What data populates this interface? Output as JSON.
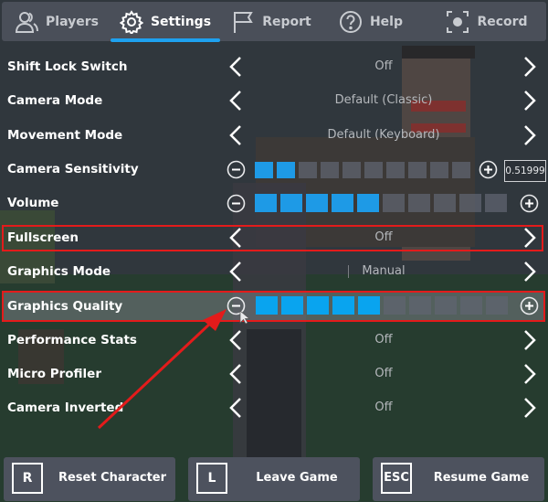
{
  "tabs": [
    {
      "label": "Players",
      "icon": "players-icon",
      "active": false
    },
    {
      "label": "Settings",
      "icon": "gear-icon",
      "active": true
    },
    {
      "label": "Report",
      "icon": "flag-icon",
      "active": false
    },
    {
      "label": "Help",
      "icon": "help-icon",
      "active": false
    },
    {
      "label": "Record",
      "icon": "record-icon",
      "active": false
    }
  ],
  "settings": {
    "shift_lock": {
      "label": "Shift Lock Switch",
      "value": "Off"
    },
    "camera_mode": {
      "label": "Camera Mode",
      "value": "Default (Classic)"
    },
    "movement_mode": {
      "label": "Movement Mode",
      "value": "Default (Keyboard)"
    },
    "camera_sensitivity": {
      "label": "Camera Sensitivity",
      "level": 2,
      "max": 10,
      "value": "0.51999"
    },
    "volume": {
      "label": "Volume",
      "level": 5,
      "max": 10
    },
    "fullscreen": {
      "label": "Fullscreen",
      "value": "Off"
    },
    "graphics_mode": {
      "label": "Graphics Mode",
      "value": "Manual"
    },
    "graphics_quality": {
      "label": "Graphics Quality",
      "level": 5,
      "max": 10
    },
    "performance_stats": {
      "label": "Performance Stats",
      "value": "Off"
    },
    "micro_profiler": {
      "label": "Micro Profiler",
      "value": "Off"
    },
    "camera_inverted": {
      "label": "Camera Inverted",
      "value": "Off"
    }
  },
  "buttons": {
    "reset": {
      "key": "R",
      "label": "Reset Character"
    },
    "leave": {
      "key": "L",
      "label": "Leave Game"
    },
    "resume": {
      "key": "ESC",
      "label": "Resume Game"
    }
  },
  "colors": {
    "accent": "#1ea1ef",
    "highlight": "#e31b1b",
    "panel": "#4a4f59"
  }
}
